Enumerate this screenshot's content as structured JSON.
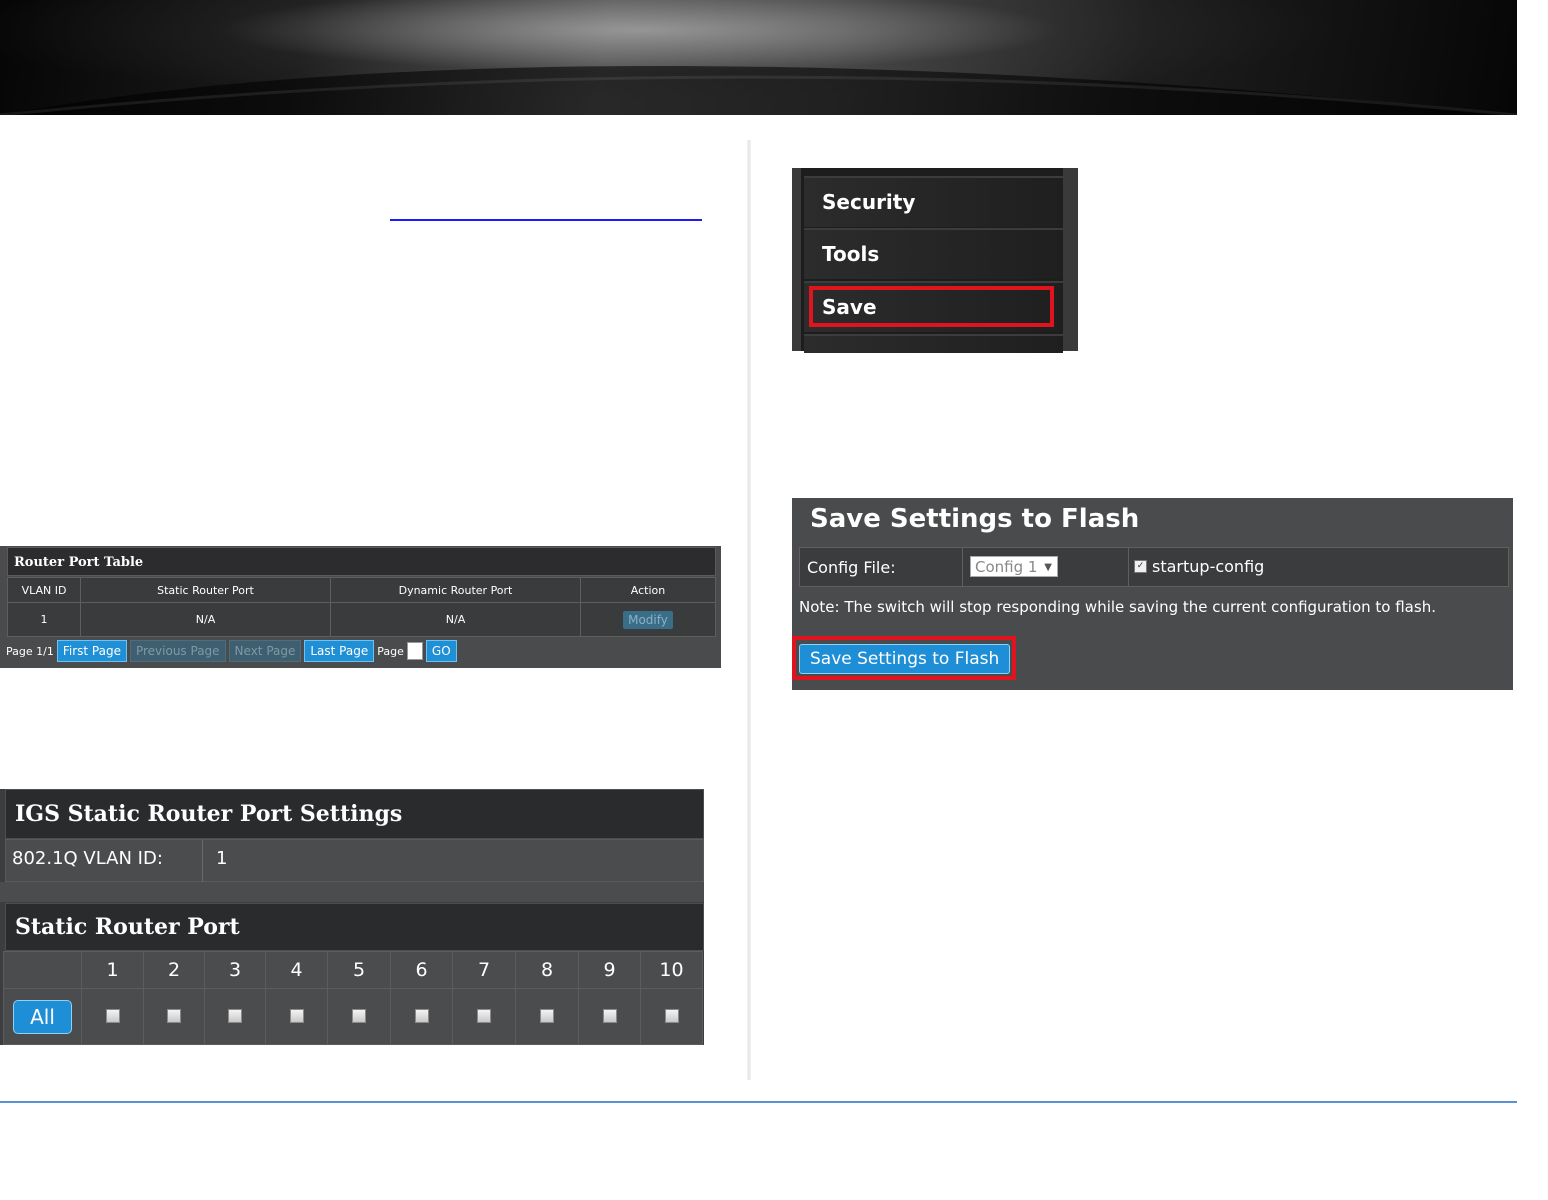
{
  "router_port_table": {
    "title": "Router Port Table",
    "columns": [
      "VLAN ID",
      "Static Router Port",
      "Dynamic Router Port",
      "Action"
    ],
    "rows": [
      {
        "vlan_id": "1",
        "static": "N/A",
        "dynamic": "N/A",
        "action": "Modify"
      }
    ],
    "pager": {
      "page_info": "Page 1/1",
      "first": "First Page",
      "previous": "Previous Page",
      "next": "Next Page",
      "last": "Last Page",
      "page_label": "Page",
      "go": "GO"
    }
  },
  "igs": {
    "title": "IGS Static Router Port Settings",
    "vlan_label": "802.1Q VLAN ID:",
    "vlan_value": "1",
    "ports_title": "Static Router Port",
    "ports": [
      "1",
      "2",
      "3",
      "4",
      "5",
      "6",
      "7",
      "8",
      "9",
      "10"
    ],
    "all_button": "All"
  },
  "menu": {
    "items": [
      "Security",
      "Tools",
      "Save"
    ],
    "highlighted": "Save"
  },
  "save_flash": {
    "title": "Save Settings to Flash",
    "config_label": "Config File:",
    "config_value": "Config 1",
    "startup_label": "startup-config",
    "startup_checked": true,
    "note": "Note: The switch will stop responding while saving the current configuration to flash.",
    "button": "Save Settings to Flash"
  },
  "colors": {
    "accent_blue": "#1e8fd6",
    "highlight_red": "#e0141e",
    "link_blue": "#1a1aff",
    "footer_line": "#5b8fd8"
  }
}
